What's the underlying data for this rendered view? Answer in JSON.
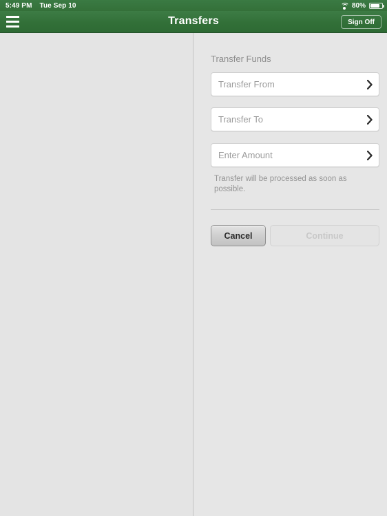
{
  "status_bar": {
    "time": "5:49 PM",
    "date": "Tue Sep 10",
    "wifi_icon": "wifi-icon",
    "battery_percent": "80%",
    "battery_icon": "battery-icon"
  },
  "nav_bar": {
    "menu_icon": "hamburger-menu-icon",
    "title": "Transfers",
    "sign_off_label": "Sign Off",
    "background_color": "#327038"
  },
  "detail": {
    "section_title": "Transfer Funds",
    "fields": [
      {
        "label": "Transfer From",
        "icon": "chevron-right-icon"
      },
      {
        "label": "Transfer To",
        "icon": "chevron-right-icon"
      },
      {
        "label": "Enter Amount",
        "icon": "chevron-right-icon"
      }
    ],
    "note": "Transfer will be processed as soon as possible.",
    "buttons": {
      "cancel_label": "Cancel",
      "continue_label": "Continue"
    }
  },
  "colors": {
    "brand_green": "#327038",
    "page_background": "#e6e6e6",
    "field_background": "#ffffff",
    "placeholder_text": "#9b9b9b"
  }
}
